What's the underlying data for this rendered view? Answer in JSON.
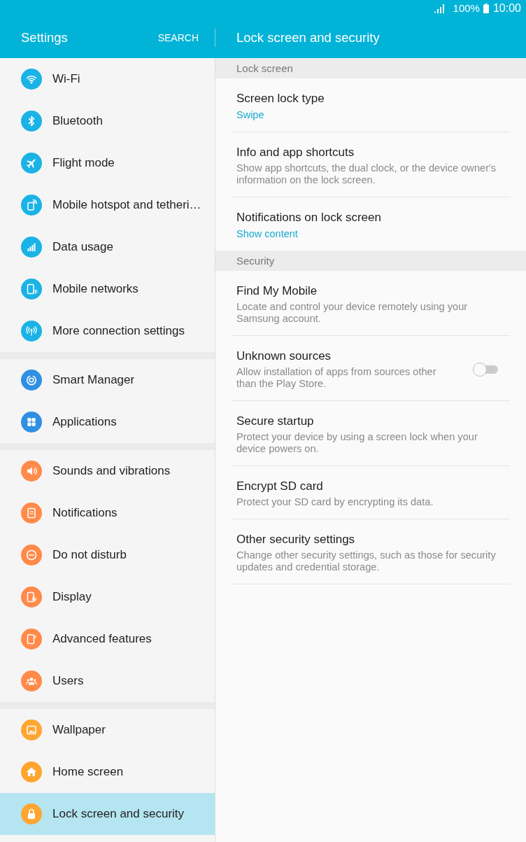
{
  "status_bar": {
    "battery": "100%",
    "time": "10:00"
  },
  "header": {
    "title": "Settings",
    "search": "SEARCH",
    "page_title": "Lock screen and security"
  },
  "sidebar": {
    "groups": [
      {
        "color": "#1ab3e6",
        "items": [
          {
            "label": "Wi-Fi",
            "selected": false
          },
          {
            "label": "Bluetooth",
            "selected": false
          },
          {
            "label": "Flight mode",
            "selected": false
          },
          {
            "label": "Mobile hotspot and tetheri…",
            "selected": false
          },
          {
            "label": "Data usage",
            "selected": false
          },
          {
            "label": "Mobile networks",
            "selected": false
          },
          {
            "label": "More connection settings",
            "selected": false
          }
        ]
      },
      {
        "color": "#2f8fe3",
        "items": [
          {
            "label": "Smart Manager",
            "selected": false
          },
          {
            "label": "Applications",
            "selected": false
          }
        ]
      },
      {
        "color": "#ff8a4a",
        "items": [
          {
            "label": "Sounds and vibrations",
            "selected": false
          },
          {
            "label": "Notifications",
            "selected": false
          },
          {
            "label": "Do not disturb",
            "selected": false
          },
          {
            "label": "Display",
            "selected": false
          },
          {
            "label": "Advanced features",
            "selected": false
          },
          {
            "label": "Users",
            "selected": false
          }
        ]
      },
      {
        "color": "#ffa530",
        "items": [
          {
            "label": "Wallpaper",
            "selected": false
          },
          {
            "label": "Home screen",
            "selected": false
          },
          {
            "label": "Lock screen and security",
            "selected": true
          }
        ]
      }
    ]
  },
  "sections": [
    {
      "header": "Lock screen",
      "items": [
        {
          "kind": "value",
          "title": "Screen lock type",
          "value": "Swipe"
        },
        {
          "kind": "text",
          "title": "Info and app shortcuts",
          "description": "Show app shortcuts, the dual clock, or the device owner's information on the lock screen."
        },
        {
          "kind": "value",
          "title": "Notifications on lock screen",
          "value": "Show content"
        }
      ]
    },
    {
      "header": "Security",
      "items": [
        {
          "kind": "text",
          "title": "Find My Mobile",
          "description": "Locate and control your device remotely using your Samsung account."
        },
        {
          "kind": "toggle",
          "title": "Unknown sources",
          "description": "Allow installation of apps from sources other than the Play Store.",
          "on": false
        },
        {
          "kind": "text",
          "title": "Secure startup",
          "description": "Protect your device by using a screen lock when your device powers on."
        },
        {
          "kind": "text",
          "title": "Encrypt SD card",
          "description": "Protect your SD card by encrypting its data."
        },
        {
          "kind": "text",
          "title": "Other security settings",
          "description": "Change other security settings, such as those for security updates and credential storage."
        }
      ]
    }
  ]
}
